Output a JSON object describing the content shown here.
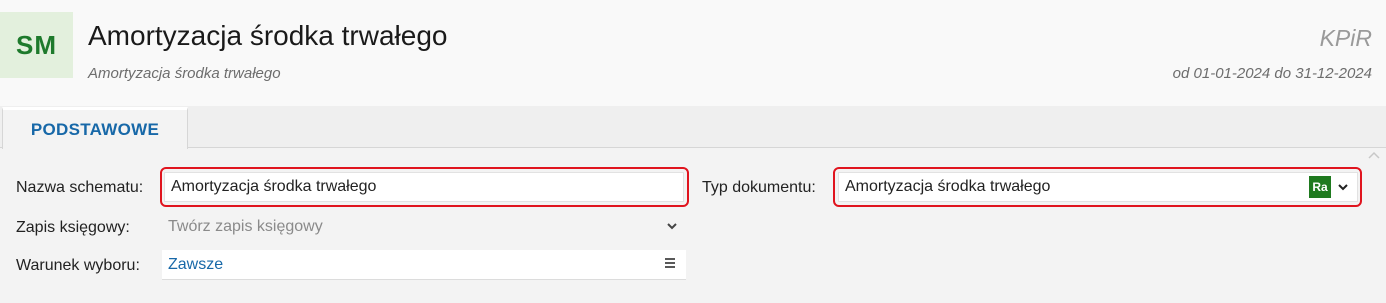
{
  "header": {
    "badge": "SM",
    "title": "Amortyzacja środka trwałego",
    "subtitle": "Amortyzacja środka trwałego",
    "module": "KPiR",
    "period": "od 01-01-2024 do 31-12-2024"
  },
  "tabs": [
    {
      "label": "PODSTAWOWE"
    }
  ],
  "form": {
    "scheme_name": {
      "label": "Nazwa schematu:",
      "value": "Amortyzacja środka trwałego"
    },
    "booking": {
      "label": "Zapis księgowy:",
      "value": "Twórz zapis księgowy"
    },
    "condition": {
      "label": "Warunek wyboru:",
      "value": "Zawsze"
    },
    "doc_type": {
      "label": "Typ dokumentu:",
      "value": "Amortyzacja środka trwałego",
      "badge": "Ra"
    }
  },
  "colors": {
    "accent": "#1768a8",
    "highlight": "#e0141e",
    "badge_green": "#1f7a1f"
  }
}
